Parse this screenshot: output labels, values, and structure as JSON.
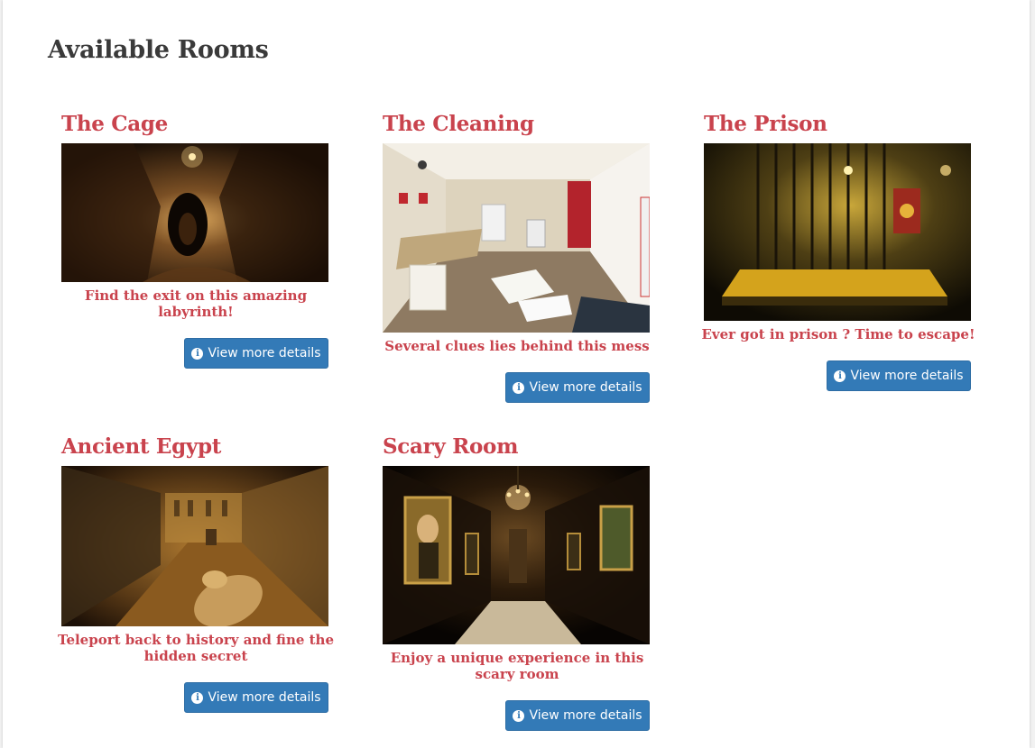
{
  "page": {
    "title": "Available Rooms"
  },
  "button_label": "View more details",
  "rooms": [
    {
      "name": "The Cage",
      "description": "Find the exit on this amazing labyrinth!",
      "image": "cave-tunnel-photo"
    },
    {
      "name": "The Cleaning",
      "description": "Several clues lies behind this mess",
      "image": "messy-room-photo"
    },
    {
      "name": "The Prison",
      "description": "Ever got in prison ? Time to escape!",
      "image": "prison-cell-photo"
    },
    {
      "name": "Ancient Egypt",
      "description": "Teleport back to history and fine the hidden secret",
      "image": "egyptian-tomb-photo"
    },
    {
      "name": "Scary Room",
      "description": "Enjoy a unique experience in this scary room",
      "image": "haunted-gallery-photo"
    }
  ],
  "colors": {
    "accent": "#c9434d",
    "button": "#337ab7",
    "heading": "#3a3a3a"
  }
}
